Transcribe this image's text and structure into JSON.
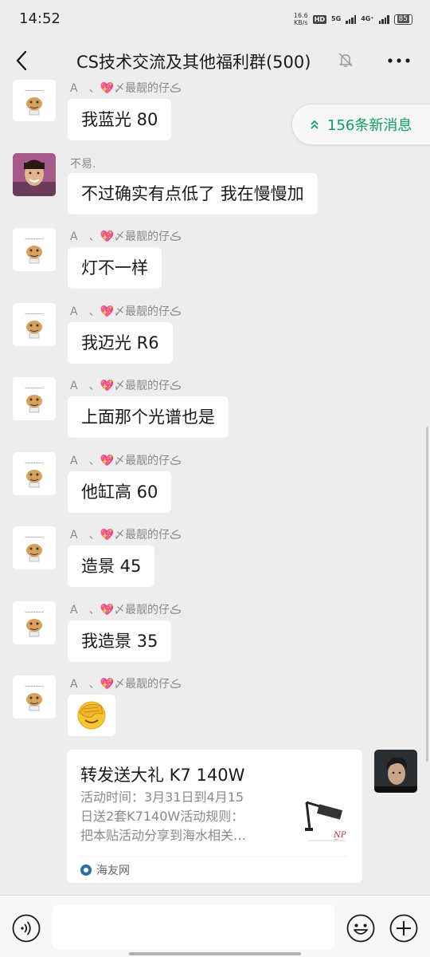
{
  "status_bar": {
    "time": "14:52",
    "speed_value": "16.6",
    "speed_unit": "KB/s",
    "hd_label": "HD",
    "net1": "5G",
    "net2": "4G⁺",
    "battery": "85"
  },
  "header": {
    "title": "CS技术交流及其他福利群(500)",
    "icons": {
      "back": "back-arrow",
      "mute": "bell-muted",
      "more": "three-dots"
    }
  },
  "new_messages_pill": {
    "label": "156条新消息",
    "color": "#07a05e"
  },
  "messages": [
    {
      "sender": "A　、💖〆最靓的仔ڪ",
      "text": "我蓝光 80"
    },
    {
      "sender": "不易.",
      "text": "不过确实有点低了 我在慢慢加"
    },
    {
      "sender": "A　、💖〆最靓的仔ڪ",
      "text": "灯不一样"
    },
    {
      "sender": "A　、💖〆最靓的仔ڪ",
      "text": "我迈光 R6"
    },
    {
      "sender": "A　、💖〆最靓的仔ڪ",
      "text": "上面那个光谱也是"
    },
    {
      "sender": "A　、💖〆最靓的仔ڪ",
      "text": "他缸高 60"
    },
    {
      "sender": "A　、💖〆最靓的仔ڪ",
      "text": "造景 45"
    },
    {
      "sender": "A　、💖〆最靓的仔ڪ",
      "text": "我造景 35"
    },
    {
      "sender": "A　、💖〆最靓的仔ڪ",
      "text": "facepalm-emoji"
    }
  ],
  "card": {
    "title": "转发送大礼 K7 140W",
    "desc_lines": [
      "活动时间：3月31日到4月15",
      "日送2套K7140W活动规则：",
      "把本贴活动分享到海水相关…"
    ],
    "source": "海友网"
  },
  "input_bar": {
    "placeholder": ""
  },
  "colors": {
    "background": "#ededed",
    "bubble": "#ffffff",
    "accent": "#07a05e"
  }
}
